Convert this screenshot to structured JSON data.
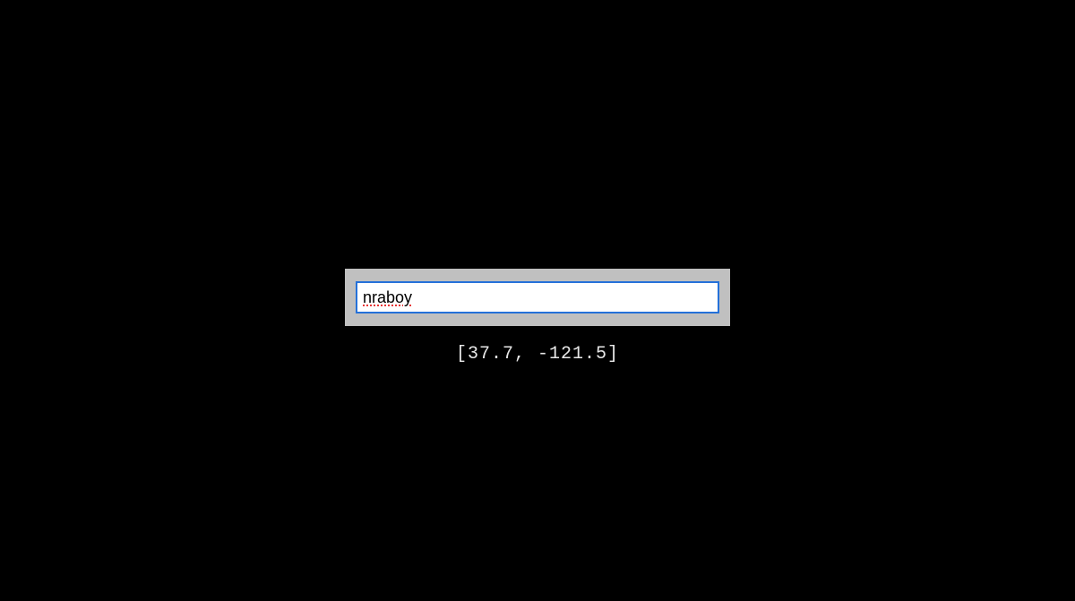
{
  "input": {
    "value": "nraboy",
    "placeholder": ""
  },
  "coords": {
    "display": "[37.7, -121.5]",
    "lat": 37.7,
    "lon": -121.5
  }
}
